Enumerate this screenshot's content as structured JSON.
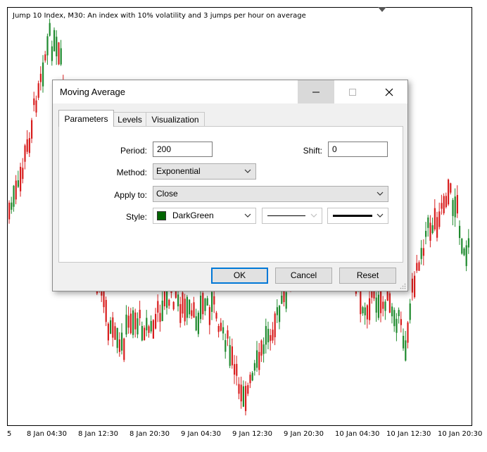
{
  "chart": {
    "title": "Jump 10 Index, M30:  An index with 10% volatility and 3 jumps per hour on average",
    "x_labels": [
      "5",
      "8 Jan 04:30",
      "8 Jan 12:30",
      "8 Jan 20:30",
      "9 Jan 04:30",
      "9 Jan 12:30",
      "9 Jan 20:30",
      "10 Jan 04:30",
      "10 Jan 12:30",
      "10 Jan 20:30"
    ],
    "up_color": "#1f8a2e",
    "down_color": "#d81e1e"
  },
  "dialog": {
    "title": "Moving Average",
    "tabs": [
      "Parameters",
      "Levels",
      "Visualization"
    ],
    "active_tab": "Parameters",
    "period_label": "Period:",
    "period_value": "200",
    "shift_label": "Shift:",
    "shift_value": "0",
    "method_label": "Method:",
    "method_value": "Exponential",
    "apply_label": "Apply to:",
    "apply_value": "Close",
    "style_label": "Style:",
    "style_color_name": "DarkGreen",
    "style_color": "#006400",
    "ok_label": "OK",
    "cancel_label": "Cancel",
    "reset_label": "Reset"
  },
  "icons": {
    "minimize": "minimize-icon",
    "maximize": "maximize-icon",
    "close": "close-icon",
    "chevron": "chevron-down-icon",
    "resize": "resize-grip-icon"
  }
}
